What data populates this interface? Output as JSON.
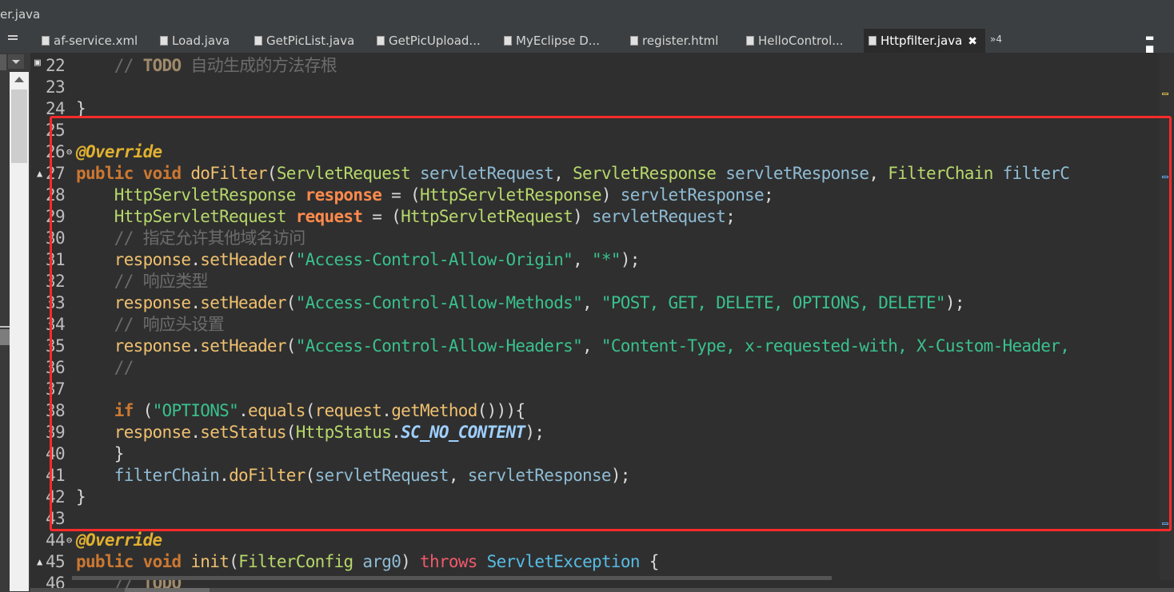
{
  "window": {
    "title": "er.java"
  },
  "tabs": [
    {
      "label": "af-service.xml",
      "icon": "xml-file-icon"
    },
    {
      "label": "Load.java",
      "icon": "java-file-icon"
    },
    {
      "label": "GetPicList.java",
      "icon": "java-file-icon"
    },
    {
      "label": "GetPicUpload...",
      "icon": "java-file-icon"
    },
    {
      "label": "MyEclipse D...",
      "icon": "grid-view-icon"
    },
    {
      "label": "register.html",
      "icon": "html-file-icon"
    },
    {
      "label": "HelloControl...",
      "icon": "java-file-icon"
    },
    {
      "label": "Httpfilter.java",
      "icon": "java-file-icon",
      "active": true,
      "close": "✖"
    }
  ],
  "tab_overflow": "»4",
  "window_controls": {
    "minimize": "▬",
    "maximize": "■"
  },
  "editor": {
    "lines": [
      {
        "n": "22",
        "c": "    // TODO 自动生成的方法存根"
      },
      {
        "n": "23",
        "c": ""
      },
      {
        "n": "24",
        "c": "}"
      },
      {
        "n": "25",
        "c": ""
      },
      {
        "n": "26",
        "c": "@Override"
      },
      {
        "n": "27",
        "c": "public void doFilter(ServletRequest servletRequest, ServletResponse servletResponse, FilterChain filterC"
      },
      {
        "n": "28",
        "c": "    HttpServletResponse response = (HttpServletResponse) servletResponse;"
      },
      {
        "n": "29",
        "c": "    HttpServletRequest request = (HttpServletRequest) servletRequest;"
      },
      {
        "n": "30",
        "c": "    // 指定允许其他域名访问"
      },
      {
        "n": "31",
        "c": "    response.setHeader(\"Access-Control-Allow-Origin\", \"*\");"
      },
      {
        "n": "32",
        "c": "    // 响应类型"
      },
      {
        "n": "33",
        "c": "    response.setHeader(\"Access-Control-Allow-Methods\", \"POST, GET, DELETE, OPTIONS, DELETE\");"
      },
      {
        "n": "34",
        "c": "    // 响应头设置"
      },
      {
        "n": "35",
        "c": "    response.setHeader(\"Access-Control-Allow-Headers\", \"Content-Type, x-requested-with, X-Custom-Header,"
      },
      {
        "n": "36",
        "c": "    //"
      },
      {
        "n": "37",
        "c": ""
      },
      {
        "n": "38",
        "c": "    if (\"OPTIONS\".equals(request.getMethod())){"
      },
      {
        "n": "39",
        "c": "    response.setStatus(HttpStatus.SC_NO_CONTENT);"
      },
      {
        "n": "40",
        "c": "    }"
      },
      {
        "n": "41",
        "c": "    filterChain.doFilter(servletRequest, servletResponse);"
      },
      {
        "n": "42",
        "c": "}"
      },
      {
        "n": "43",
        "c": ""
      },
      {
        "n": "44",
        "c": "@Override"
      },
      {
        "n": "45",
        "c": "public void init(FilterConfig arg0) throws ServletException {"
      },
      {
        "n": "46",
        "c": "    // TODO"
      }
    ]
  }
}
